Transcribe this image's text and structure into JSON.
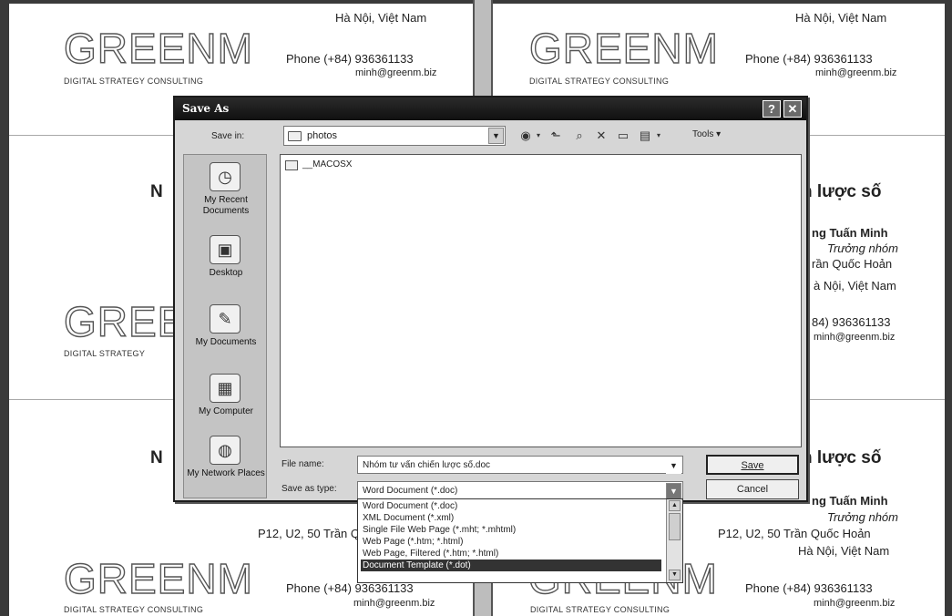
{
  "background": {
    "cards": {
      "logo": "GREENM",
      "tagline": "DIGITAL STRATEGY CONSULTING",
      "address_city": "Hà Nội, Việt Nam",
      "phone": "Phone (+84) 936361133",
      "email": "minh@greenm.biz",
      "address_street": "P12, U2, 50 Trần Quốc Hoản",
      "title_fragment_left": "N",
      "title_fragment_right": "n lược số",
      "name_fragment": "ng Tuấn Minh",
      "role": "Trưởng nhóm",
      "street_fragment": "rần Quốc Hoản",
      "city_fragment": "à Nội, Việt Nam",
      "phone_fragment": "84) 936361133",
      "email_fragment": "minh@greenm.biz",
      "tagline_fragment": "DIGITAL STRATEGY"
    }
  },
  "dialog": {
    "title": "Save As",
    "help_button": "?",
    "close_button": "✕",
    "save_in_label": "Save in:",
    "save_in_value": "photos",
    "tools_label": "Tools",
    "places": [
      {
        "label": "My Recent Documents",
        "icon": "recent-documents-icon"
      },
      {
        "label": "Desktop",
        "icon": "desktop-icon"
      },
      {
        "label": "My Documents",
        "icon": "my-documents-icon"
      },
      {
        "label": "My Computer",
        "icon": "my-computer-icon"
      },
      {
        "label": "My Network Places",
        "icon": "network-places-icon"
      }
    ],
    "files": [
      {
        "name": "__MACOSX",
        "type": "folder"
      }
    ],
    "file_name_label": "File name:",
    "file_name_value": "Nhóm tư vấn chiến lược số.doc",
    "save_as_type_label": "Save as type:",
    "save_as_type_value": "Word Document (*.doc)",
    "save_button": "Save",
    "cancel_button": "Cancel",
    "type_options": [
      "Word Document (*.doc)",
      "XML Document (*.xml)",
      "Single File Web Page (*.mht; *.mhtml)",
      "Web Page (*.htm; *.html)",
      "Web Page, Filtered (*.htm; *.html)",
      "Document Template (*.dot)"
    ],
    "selected_type_option": "Document Template (*.dot)"
  },
  "colors": {
    "titlebar": "#1a1a1a",
    "dialog_face": "#d6d6d6",
    "selection": "#333333"
  }
}
